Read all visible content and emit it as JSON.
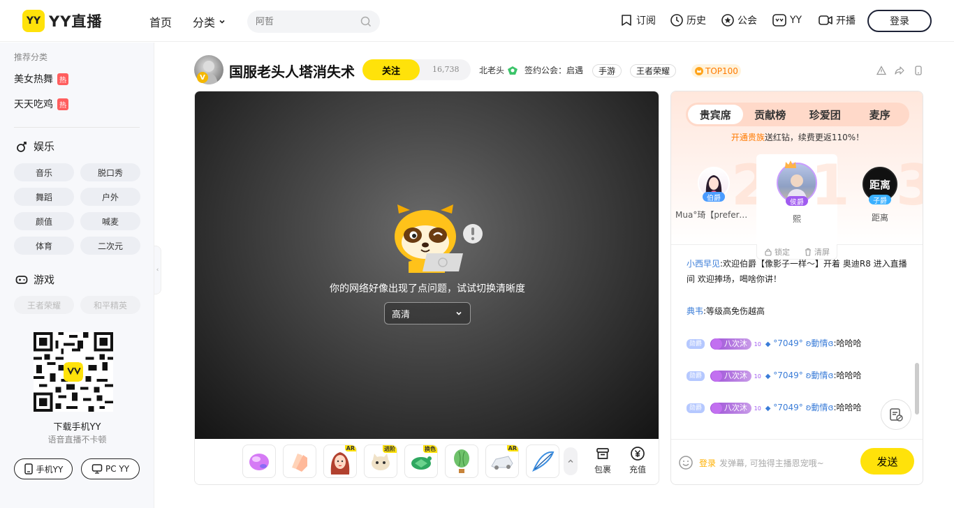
{
  "brand": {
    "logo_badge": "YY",
    "logo_text": "YY直播"
  },
  "nav": {
    "home": "首页",
    "category": "分类"
  },
  "search": {
    "placeholder": "阿哲"
  },
  "tools": {
    "subscribe": "订阅",
    "history": "历史",
    "guild": "公会",
    "yy": "YY",
    "broadcast": "开播"
  },
  "login_button": "登录",
  "sidebar": {
    "title": "推荐分类",
    "recommended": [
      {
        "label": "美女热舞",
        "hot": "热"
      },
      {
        "label": "天天吃鸡",
        "hot": "热"
      }
    ],
    "entertainment": {
      "label": "娱乐",
      "chips": [
        "音乐",
        "脱口秀",
        "舞蹈",
        "户外",
        "颜值",
        "喊麦",
        "体育",
        "二次元"
      ]
    },
    "game": {
      "label": "游戏",
      "chips": [
        "王者荣耀",
        "和平精英"
      ]
    },
    "download": {
      "title": "下载手机YY",
      "subtitle": "语音直播不卡顿",
      "mobile_btn": "手机YY",
      "pc_btn": "PC YY"
    }
  },
  "room": {
    "title": "国服老头人塔消失术",
    "follow": "关注",
    "fans": "16,738",
    "host": "北老头",
    "guild": "签约公会：启遇",
    "tags": [
      "手游",
      "王者荣耀"
    ],
    "rank": "TOP100"
  },
  "player": {
    "error_message": "你的网络好像出现了点问题，试试切换清晰度",
    "quality": "高清",
    "gift_badges": [
      "AR",
      "进阶",
      "换色",
      "AR"
    ],
    "package": "包裹",
    "recharge": "充值"
  },
  "panel": {
    "tabs": [
      "贵宾席",
      "贡献榜",
      "珍爱团",
      "麦序"
    ],
    "promo_highlight": "开通贵族",
    "promo_rest": "送红钻，续费更返110%！",
    "seats": [
      {
        "name": "Mua°琦【prefere…",
        "badge": "伯爵",
        "badge_color": "#4a9cff"
      },
      {
        "name": "熙",
        "badge": "侯爵",
        "badge_color": "#a05bf0"
      },
      {
        "name": "距离",
        "badge": "子爵",
        "badge_color": "#3ab0ff"
      }
    ],
    "rank_numbers": [
      "2",
      "1",
      "3"
    ],
    "lock": "锁定",
    "clear": "清屏",
    "chat": [
      {
        "user": "小西早见",
        "text": ":欢迎伯爵【像影子一样～】开着 奥迪R8 进入直播",
        "text2": "间 欢迎捧场，喝啥你讲！"
      },
      {
        "user": "典韦",
        "text": ":等级高免伤越高"
      },
      {
        "noble": "勋爵",
        "fan": "八次沐",
        "level": "10",
        "user": "°7049° ʚ動情ɞ",
        "text": ":哈哈哈"
      },
      {
        "noble": "勋爵",
        "fan": "八次沐",
        "level": "10",
        "user": "°7049° ʚ動情ɞ",
        "text": ":哈哈哈"
      },
      {
        "noble": "勋爵",
        "fan": "八次沐",
        "level": "10",
        "user": "°7049° ʚ動情ɞ",
        "text": ":哈哈哈"
      }
    ],
    "input_login": "登录",
    "input_placeholder": "发弹幕, 可独得主播恩宠哦~",
    "send": "发送"
  },
  "colors": {
    "brand_yellow": "#ffe20a",
    "accent_orange": "#ff7a00",
    "link_blue": "#3b7dd8"
  }
}
